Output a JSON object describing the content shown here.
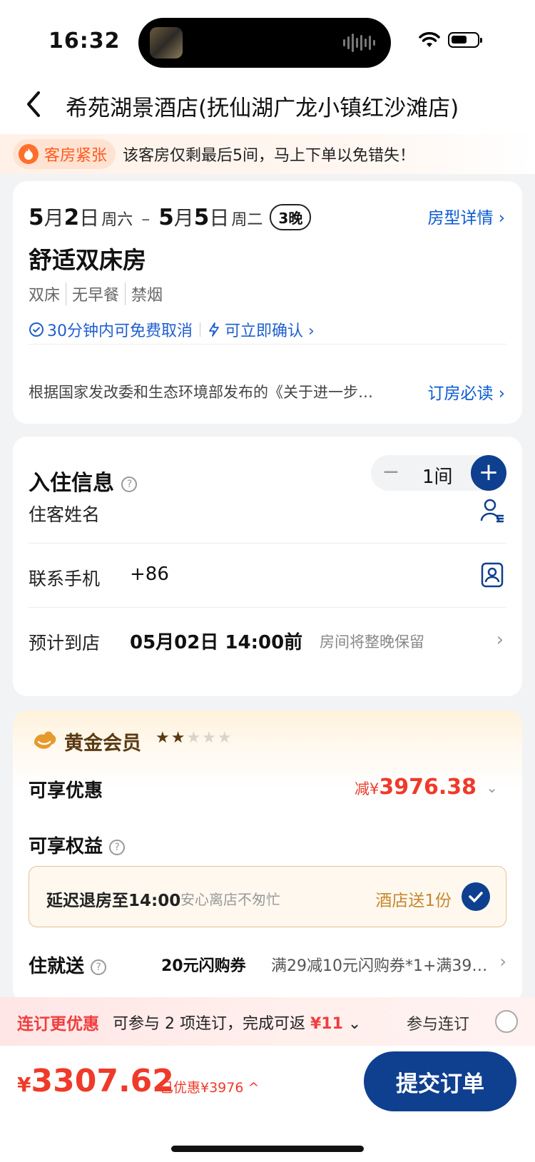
{
  "status": {
    "time": "16:32"
  },
  "nav": {
    "title": "希苑湖景酒店(抚仙湖广龙小镇红沙滩店)"
  },
  "urgency": {
    "tag": "客房紧张",
    "text": "该客房仅剩最后5间，马上下单以免错失！"
  },
  "room": {
    "check_in": {
      "date_num": "5",
      "month": "月",
      "day": "2",
      "day_suffix": "日",
      "weekday": "周六"
    },
    "dash": "–",
    "check_out": {
      "date_num": "5",
      "month": "月",
      "day": "5",
      "day_suffix": "日",
      "weekday": "周二"
    },
    "nights": "3晚",
    "detail_link": "房型详情 ›",
    "name": "舒适双床房",
    "attributes": [
      "双床",
      "无早餐",
      "禁烟"
    ],
    "cancel_policy": "30分钟内可免费取消",
    "confirm_policy": "可立即确认 ›",
    "notice": "根据国家发改委和生态环境部发布的《关于进一步…",
    "notice_link": "订房必读 ›"
  },
  "guest": {
    "title": "入住信息",
    "help": "?",
    "rooms_count": "1间",
    "minus": "−",
    "plus": "+",
    "name_label": "住客姓名",
    "phone_label": "联系手机",
    "phone_prefix": "+86",
    "arrival_label": "预计到店",
    "arrival_time": "05月02日 14:00前",
    "arrival_note": "房间将整晚保留",
    "chevron": "›"
  },
  "member": {
    "level": "黄金会员",
    "stars_on": "★★",
    "stars_off": "★★★",
    "discount_label": "可享优惠",
    "discount_prefix": "减¥",
    "discount_value": "3976.38",
    "discount_chevron": "⌄",
    "benefit_label": "可享权益",
    "benefit_main": "延迟退房至14:00",
    "benefit_sub": "安心离店不匆忙",
    "benefit_gift": "酒店送1份",
    "stay_label": "住就送",
    "stay_coupon": "20元闪购券",
    "stay_detail": "满29减10元闪购券*1+满39…",
    "stay_chevron": "›"
  },
  "combo": {
    "tag": "连订更优惠",
    "text_prefix": "可参与 2 项连订，完成可返 ",
    "amount": "¥11",
    "text_suffix": " ⌄",
    "join": "参与连订"
  },
  "footer": {
    "price_symbol": "¥",
    "price_value": "3307.62",
    "saved": "已优惠¥3976 ^",
    "submit": "提交订单"
  },
  "colors": {
    "brand_blue": "#0f3f8f",
    "price_red": "#ef3a2a",
    "link_blue": "#0b5bd3",
    "gold": "#c5892f"
  }
}
